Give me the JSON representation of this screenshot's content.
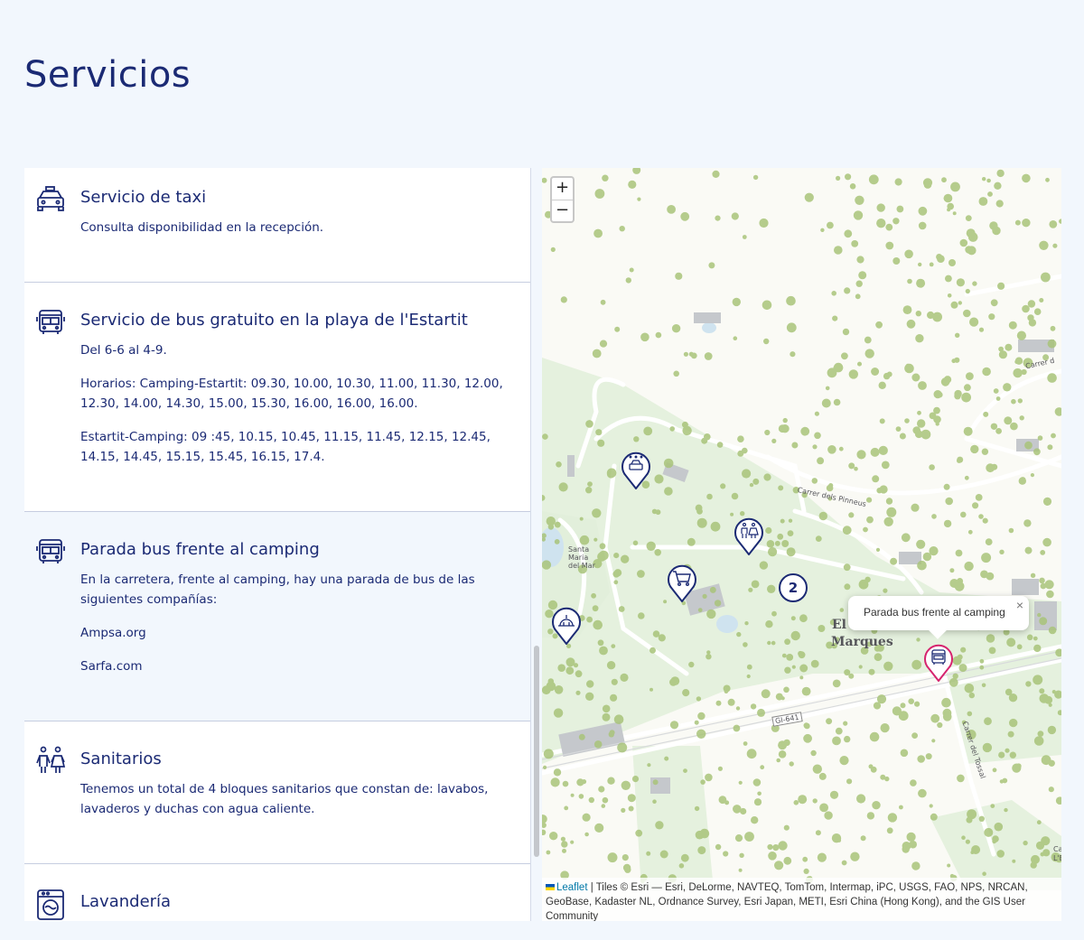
{
  "page": {
    "title": "Servicios"
  },
  "services": [
    {
      "icon": "taxi-icon",
      "title": "Servicio de taxi",
      "texts": [
        "Consulta disponibilidad en la recepción."
      ]
    },
    {
      "icon": "bus-icon",
      "title": "Servicio de bus gratuito en la playa de l'Estartit",
      "texts": [
        "Del 6-6 al 4-9.",
        "Horarios: Camping-Estartit: 09.30, 10.00, 10.30, 11.00, 11.30, 12.00, 12.30, 14.00, 14.30, 15.00, 15.30, 16.00, 16.00, 16.00.",
        "Estartit-Camping: 09 :45, 10.15, 10.45, 11.15, 11.45, 12.15, 12.45, 14.15, 14.45, 15.15, 15.45, 16.15, 17.4."
      ]
    },
    {
      "icon": "bus-icon",
      "title": "Parada bus frente al camping",
      "texts": [
        "En la carretera, frente al camping, hay una parada de bus de las siguientes compañías:",
        "Ampsa.org",
        "Sarfa.com"
      ]
    },
    {
      "icon": "restrooms-icon",
      "title": "Sanitarios",
      "texts": [
        "Tenemos un total de 4 bloques sanitarios que constan de: lavabos, lavaderos y duchas con agua caliente."
      ]
    },
    {
      "icon": "washing-machine-icon",
      "title": "Lavandería",
      "texts": []
    }
  ],
  "map": {
    "zoom_in": "+",
    "zoom_out": "−",
    "cluster_count": "2",
    "popup": {
      "text": "Parada bus frente al camping",
      "close": "×"
    },
    "labels": {
      "area_name_1": "El",
      "area_name_2": "Marques",
      "church_1": "Santa",
      "church_2": "Maria",
      "church_3": "del Mar",
      "street_pinneus": "Carrer dels Pinneus",
      "street_tossal": "Carrer del Tossal",
      "road_gi641": "GI-641",
      "street_top": "Carrer d",
      "edge_label": "Ca L'Er"
    },
    "attribution": {
      "leaflet": "Leaflet",
      "text": "| Tiles © Esri — Esri, DeLorme, NAVTEQ, TomTom, Intermap, iPC, USGS, FAO, NPS, NRCAN, GeoBase, Kadaster NL, Ordnance Survey, Esri Japan, METI, Esri China (Hong Kong), and the GIS User Community"
    },
    "colors": {
      "marker": "#1b2a74",
      "active_marker": "#d6246e",
      "vegetation": "#a9c47a",
      "park": "#e3f0dd"
    }
  }
}
